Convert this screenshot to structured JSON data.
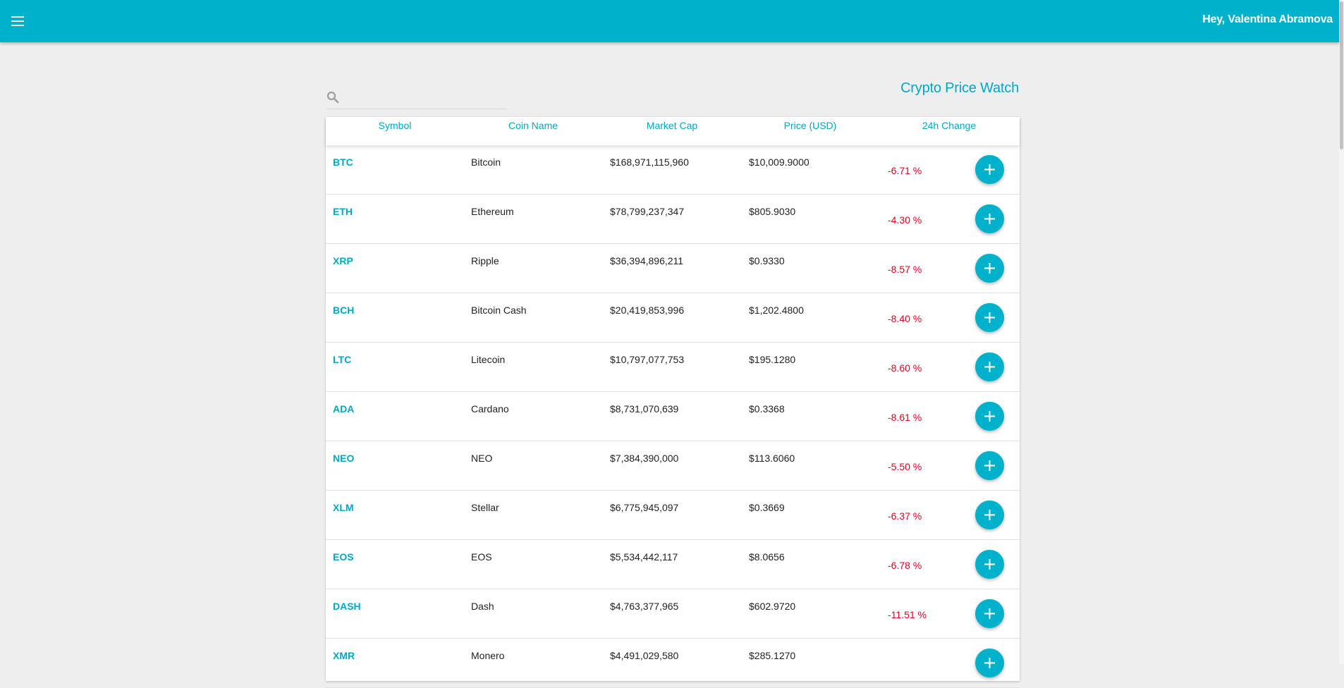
{
  "header": {
    "greeting": "Hey, Valentina Abramova",
    "menu_icon": "hamburger-menu-icon",
    "color": "#00b1cc"
  },
  "search": {
    "placeholder": "",
    "value": "",
    "icon": "search-icon"
  },
  "page": {
    "title": "Crypto Price Watch"
  },
  "table": {
    "columns": [
      "Symbol",
      "Coin Name",
      "Market Cap",
      "Price (USD)",
      "24h Change"
    ],
    "add_icon": "plus-icon",
    "negative_color": "#e5001f",
    "rows": [
      {
        "symbol": "BTC",
        "name": "Bitcoin",
        "market_cap": "$168,971,115,960",
        "price": "$10,009.9000",
        "change": "-6.71 %"
      },
      {
        "symbol": "ETH",
        "name": "Ethereum",
        "market_cap": "$78,799,237,347",
        "price": "$805.9030",
        "change": "-4.30 %"
      },
      {
        "symbol": "XRP",
        "name": "Ripple",
        "market_cap": "$36,394,896,211",
        "price": "$0.9330",
        "change": "-8.57 %"
      },
      {
        "symbol": "BCH",
        "name": "Bitcoin Cash",
        "market_cap": "$20,419,853,996",
        "price": "$1,202.4800",
        "change": "-8.40 %"
      },
      {
        "symbol": "LTC",
        "name": "Litecoin",
        "market_cap": "$10,797,077,753",
        "price": "$195.1280",
        "change": "-8.60 %"
      },
      {
        "symbol": "ADA",
        "name": "Cardano",
        "market_cap": "$8,731,070,639",
        "price": "$0.3368",
        "change": "-8.61 %"
      },
      {
        "symbol": "NEO",
        "name": "NEO",
        "market_cap": "$7,384,390,000",
        "price": "$113.6060",
        "change": "-5.50 %"
      },
      {
        "symbol": "XLM",
        "name": "Stellar",
        "market_cap": "$6,775,945,097",
        "price": "$0.3669",
        "change": "-6.37 %"
      },
      {
        "symbol": "EOS",
        "name": "EOS",
        "market_cap": "$5,534,442,117",
        "price": "$8.0656",
        "change": "-6.78 %"
      },
      {
        "symbol": "DASH",
        "name": "Dash",
        "market_cap": "$4,763,377,965",
        "price": "$602.9720",
        "change": "-11.51 %"
      },
      {
        "symbol": "XMR",
        "name": "Monero",
        "market_cap": "$4,491,029,580",
        "price": "$285.1270",
        "change": ""
      }
    ]
  }
}
